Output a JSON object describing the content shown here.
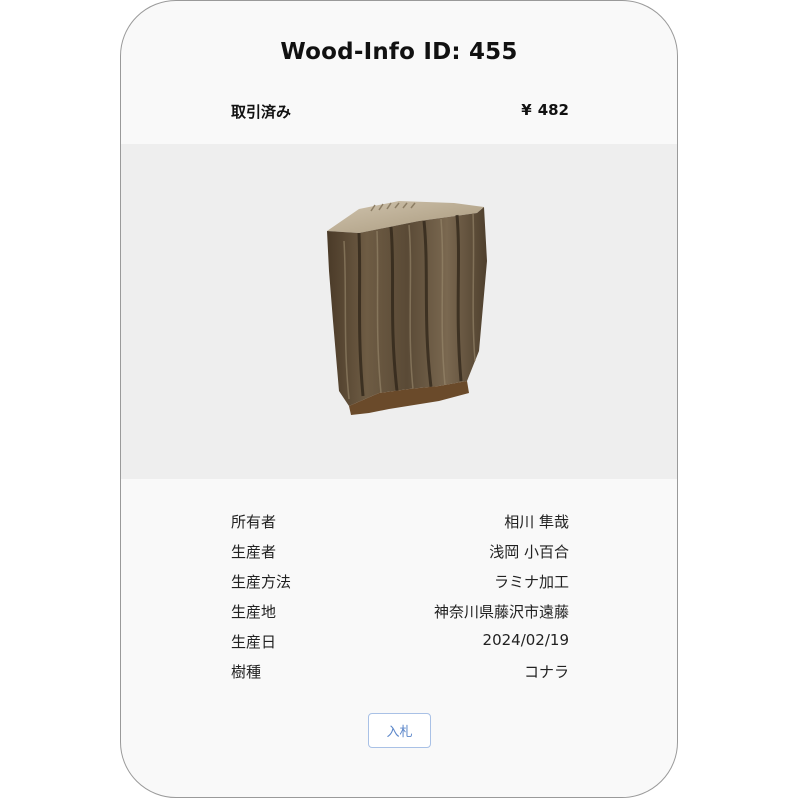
{
  "header": {
    "title": "Wood-Info ID: 455"
  },
  "status": {
    "label": "取引済み",
    "currency_symbol": "¥",
    "price": "482"
  },
  "image": {
    "subject": "wood-log-block"
  },
  "details": [
    {
      "label": "所有者",
      "value": "相川 隼哉"
    },
    {
      "label": "生産者",
      "value": "浅岡 小百合"
    },
    {
      "label": "生産方法",
      "value": "ラミナ加工"
    },
    {
      "label": "生産地",
      "value": "神奈川県藤沢市遠藤"
    },
    {
      "label": "生産日",
      "value": "2024/02/19"
    },
    {
      "label": "樹種",
      "value": "コナラ"
    }
  ],
  "actions": {
    "bid_label": "入札"
  },
  "colors": {
    "card_background": "#f9f9f9",
    "image_background": "#eeeeee",
    "button_text": "#5b86c9",
    "button_border": "#a9c1e6"
  }
}
